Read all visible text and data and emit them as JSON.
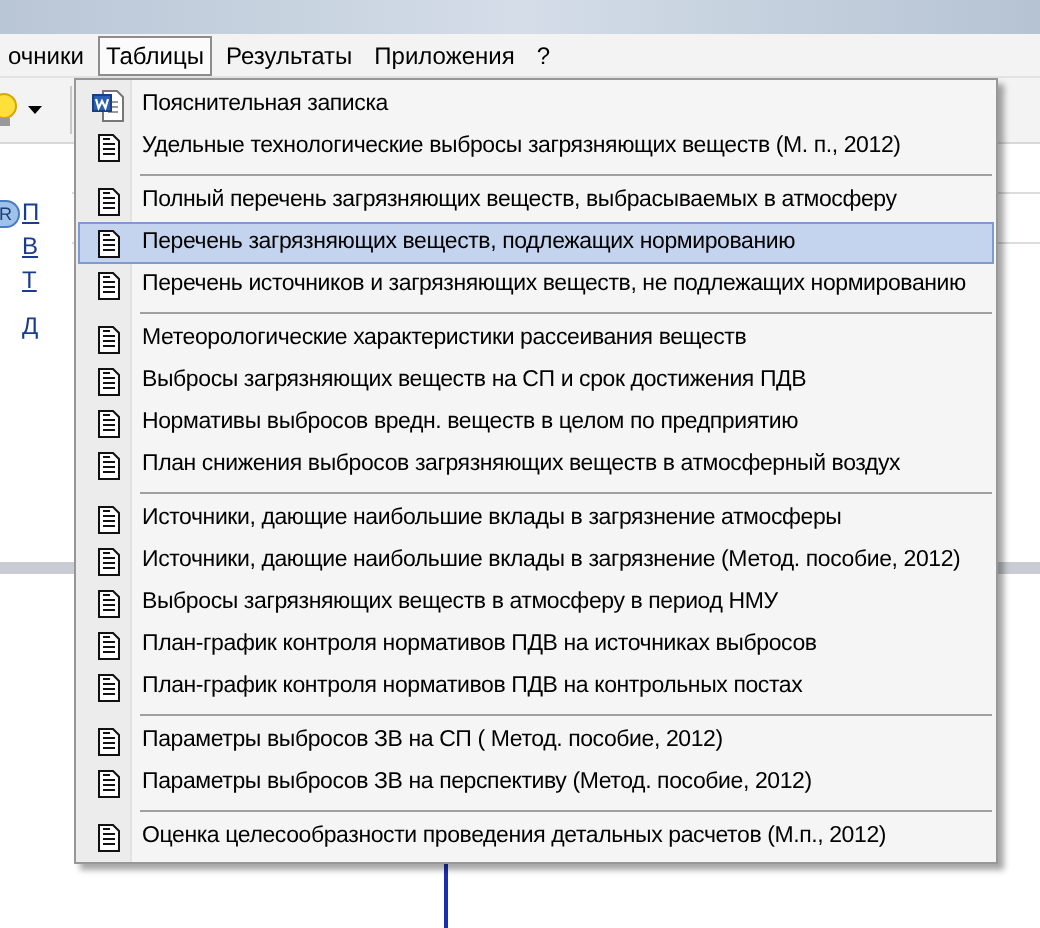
{
  "menu_bar": [
    {
      "label": "очники",
      "selected": false
    },
    {
      "label": "Таблицы",
      "selected": true
    },
    {
      "label": "Результаты",
      "selected": false
    },
    {
      "label": "Приложения",
      "selected": false
    },
    {
      "label": "?",
      "selected": false
    }
  ],
  "background_panel": {
    "badge": "R",
    "links": [
      "П",
      "В",
      "Т",
      "Д"
    ]
  },
  "menu_groups": [
    {
      "items": [
        {
          "kind": "word",
          "label": "Пояснительная записка",
          "selected": false
        },
        {
          "kind": "doc",
          "label": "Удельные технологические выбросы загрязняющих веществ (М. п.,  2012)",
          "selected": false
        }
      ]
    },
    {
      "items": [
        {
          "kind": "doc",
          "label": "Полный перечень загрязняющих веществ, выбрасываемых в атмосферу",
          "selected": false
        },
        {
          "kind": "doc",
          "label": "Перечень загрязняющих веществ, подлежащих нормированию",
          "selected": true
        },
        {
          "kind": "doc",
          "label": "Перечень источников и загрязняющих веществ, не подлежащих нормированию",
          "selected": false
        }
      ]
    },
    {
      "items": [
        {
          "kind": "doc",
          "label": "Метеорологические характеристики рассеивания веществ",
          "selected": false
        },
        {
          "kind": "doc",
          "label": "Выбросы загрязняющих веществ на СП и срок достижения ПДВ",
          "selected": false
        },
        {
          "kind": "doc",
          "label": "Нормативы выбросов вредн. веществ в целом по предприятию",
          "selected": false
        },
        {
          "kind": "doc",
          "label": "План снижения выбросов загрязняющих веществ в атмосферный воздух",
          "selected": false
        }
      ]
    },
    {
      "items": [
        {
          "kind": "doc",
          "label": "Источники, дающие наибольшие вклады в загрязнение атмосферы",
          "selected": false
        },
        {
          "kind": "doc",
          "label": "Источники, дающие наибольшие вклады в загрязнение (Метод. пособие, 2012)",
          "selected": false
        },
        {
          "kind": "doc",
          "label": "Выбросы загрязняющих веществ в атмосферу в период НМУ",
          "selected": false
        },
        {
          "kind": "doc",
          "label": "План-график контроля нормативов ПДВ на источниках выбросов",
          "selected": false
        },
        {
          "kind": "doc",
          "label": "План-график контроля нормативов ПДВ на контрольных постах",
          "selected": false
        }
      ]
    },
    {
      "items": [
        {
          "kind": "doc",
          "label": "Параметры выбросов ЗВ на СП  ( Метод. пособие, 2012)",
          "selected": false
        },
        {
          "kind": "doc",
          "label": "Параметры выбросов ЗВ на перспективу  (Метод. пособие, 2012)",
          "selected": false
        }
      ]
    },
    {
      "items": [
        {
          "kind": "doc",
          "label": "Оценка целесообразности проведения детальных расчетов  (М.п., 2012)",
          "selected": false
        }
      ]
    }
  ]
}
